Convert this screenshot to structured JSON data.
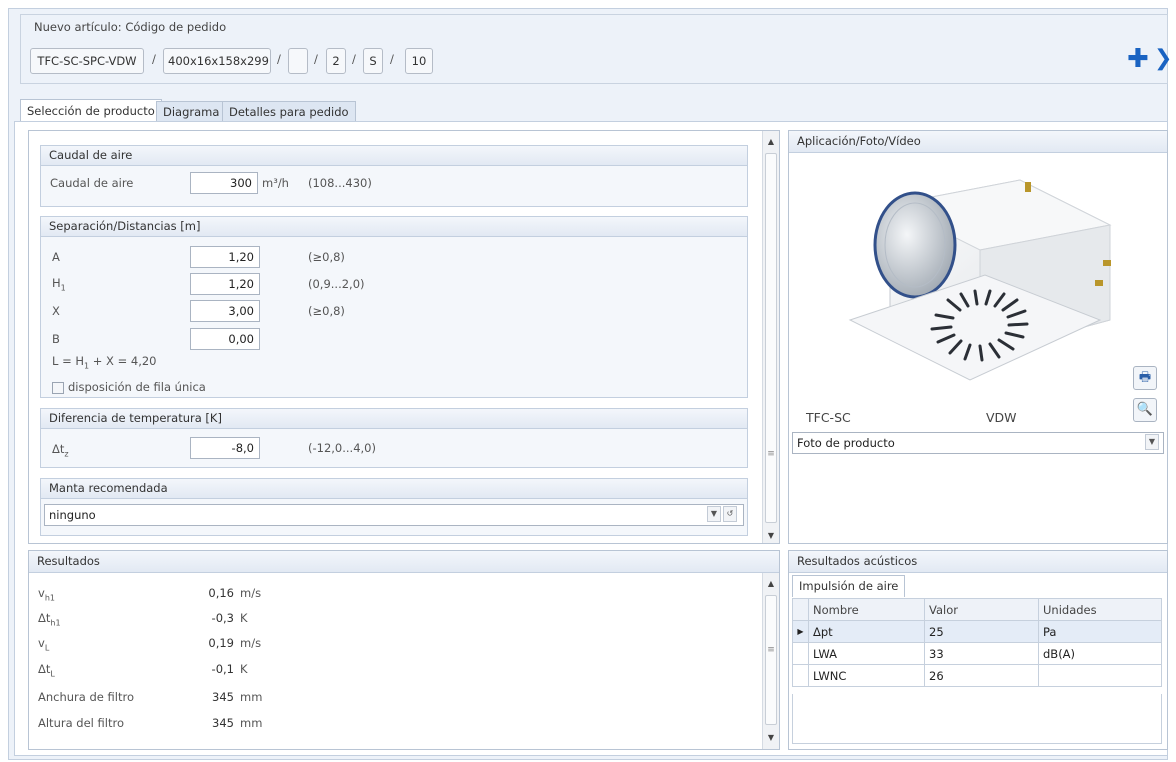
{
  "order": {
    "title": "Nuevo artículo: Código de pedido",
    "codes": [
      "TFC-SC-SPC-VDW",
      "400x16x158x299",
      "",
      "2",
      "S",
      "10"
    ],
    "separator": "/"
  },
  "tabs": [
    {
      "label": "Selección de producto",
      "active": true
    },
    {
      "label": "Diagrama",
      "active": false
    },
    {
      "label": "Detalles para pedido",
      "active": false
    }
  ],
  "airflow": {
    "header": "Caudal de aire",
    "label": "Caudal de aire",
    "value": "300",
    "unit": "m³/h",
    "range": "(108...430)"
  },
  "distances": {
    "header": "Separación/Distancias [m]",
    "fields": [
      {
        "label": "A",
        "value": "1,20",
        "range": "(≥0,8)"
      },
      {
        "label": "H",
        "sub": "1",
        "value": "1,20",
        "range": "(0,9...2,0)"
      },
      {
        "label": "X",
        "value": "3,00",
        "range": "(≥0,8)"
      },
      {
        "label": "B",
        "value": "0,00",
        "range": ""
      }
    ],
    "formula_prefix": "L = H",
    "formula_sub": "1",
    "formula_suffix": " + X = 4,20",
    "single_row_label": "disposición de fila única",
    "single_row_checked": false
  },
  "temperature": {
    "header": "Diferencia de temperatura [K]",
    "label": "Δt",
    "sub": "z",
    "value": "-8,0",
    "range": "(-12,0...4,0)"
  },
  "plenum": {
    "header": "Manta recomendada",
    "value": "ninguno"
  },
  "media": {
    "header": "Aplicación/Foto/Vídeo",
    "caption_left": "TFC-SC",
    "caption_right": "VDW",
    "select_value": "Foto de producto"
  },
  "results": {
    "header": "Resultados",
    "rows": [
      {
        "label": "v",
        "sub": "h1",
        "value": "0,16",
        "unit": "m/s"
      },
      {
        "label": "Δt",
        "sub": "h1",
        "value": "-0,3",
        "unit": "K"
      },
      {
        "label": "v",
        "sub": "L",
        "value": "0,19",
        "unit": "m/s"
      },
      {
        "label": "Δt",
        "sub": "L",
        "value": "-0,1",
        "unit": "K"
      },
      {
        "label": "Anchura de filtro",
        "sub": "",
        "value": "345",
        "unit": "mm"
      },
      {
        "label": "Altura del filtro",
        "sub": "",
        "value": "345",
        "unit": "mm"
      }
    ]
  },
  "acoustic": {
    "header": "Resultados acústicos",
    "tab": "Impulsión de aire",
    "columns": [
      "Nombre",
      "Valor",
      "Unidades"
    ],
    "rows": [
      {
        "name": "Δpt",
        "value": "25",
        "unit": "Pa",
        "selected": true
      },
      {
        "name": "LWA",
        "value": "33",
        "unit": "dB(A)",
        "selected": false
      },
      {
        "name": "LWNC",
        "value": "26",
        "unit": "",
        "selected": false
      }
    ]
  },
  "colors": {
    "accent": "#1a63c2",
    "panel_header": "#e2e9f3",
    "border": "#b8c4d4"
  }
}
